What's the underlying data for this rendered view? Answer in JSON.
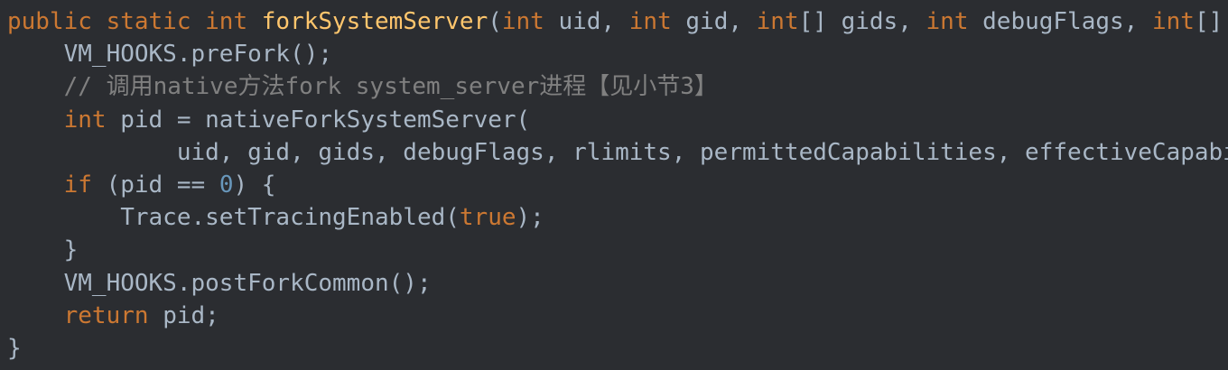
{
  "colors": {
    "background": "#2b2d31",
    "keyword": "#cc7832",
    "method": "#ffc66d",
    "text": "#a9b7c6",
    "comment": "#808080",
    "number": "#6897bb"
  },
  "code": {
    "lines": [
      [
        [
          "kw",
          "public static int "
        ],
        [
          "fn",
          "forkSystemServer"
        ],
        [
          "tx",
          "("
        ],
        [
          "kw",
          "int"
        ],
        [
          "tx",
          " uid, "
        ],
        [
          "kw",
          "int"
        ],
        [
          "tx",
          " gid, "
        ],
        [
          "kw",
          "int"
        ],
        [
          "tx",
          "[] gids, "
        ],
        [
          "kw",
          "int"
        ],
        [
          "tx",
          " debugFlags, "
        ],
        [
          "kw",
          "int"
        ],
        [
          "tx",
          "[]"
        ]
      ],
      [
        [
          "tx",
          "    VM_HOOKS.preFork();"
        ]
      ],
      [
        [
          "cm",
          "    // 调用native方法fork system_server进程【见小节3】"
        ]
      ],
      [
        [
          "kw",
          "    int"
        ],
        [
          "tx",
          " pid = nativeForkSystemServer("
        ]
      ],
      [
        [
          "tx",
          "            uid, gid, gids, debugFlags, rlimits, permittedCapabilities, effectiveCapabi"
        ]
      ],
      [
        [
          "kw",
          "    if"
        ],
        [
          "tx",
          " (pid == "
        ],
        [
          "num",
          "0"
        ],
        [
          "tx",
          ") {"
        ]
      ],
      [
        [
          "tx",
          "        Trace.setTracingEnabled("
        ],
        [
          "kw",
          "true"
        ],
        [
          "tx",
          ");"
        ]
      ],
      [
        [
          "tx",
          "    }"
        ]
      ],
      [
        [
          "tx",
          "    VM_HOOKS.postForkCommon();"
        ]
      ],
      [
        [
          "kw",
          "    return"
        ],
        [
          "tx",
          " pid;"
        ]
      ],
      [
        [
          "tx",
          "}"
        ]
      ]
    ]
  }
}
